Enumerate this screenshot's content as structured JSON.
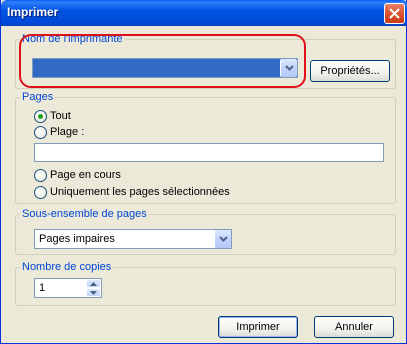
{
  "window": {
    "title": "Imprimer"
  },
  "printer_group": {
    "legend": "Nom de l'imprimante",
    "selected_value": "",
    "properties_label": "Propriétés..."
  },
  "pages_group": {
    "legend": "Pages",
    "options": [
      {
        "label": "Tout",
        "checked": true
      },
      {
        "label": "Plage :",
        "checked": false
      },
      {
        "label": "Page en cours",
        "checked": false
      },
      {
        "label": "Uniquement les pages sélectionnées",
        "checked": false
      }
    ],
    "range_value": ""
  },
  "subset_group": {
    "legend": "Sous-ensemble de pages",
    "selected_value": "Pages impaires"
  },
  "copies_group": {
    "legend": "Nombre de copies",
    "value": "1"
  },
  "buttons": {
    "print_label": "Imprimer",
    "cancel_label": "Annuler"
  },
  "colors": {
    "title_bar": "#0054e3",
    "group_legend": "#0046d5",
    "highlight_ring": "#e0101b",
    "selection": "#316ac5"
  },
  "icons": {
    "close": "close-icon",
    "dropdown": "chevron-down-icon",
    "spin_up": "spin-up-icon",
    "spin_down": "spin-down-icon"
  }
}
